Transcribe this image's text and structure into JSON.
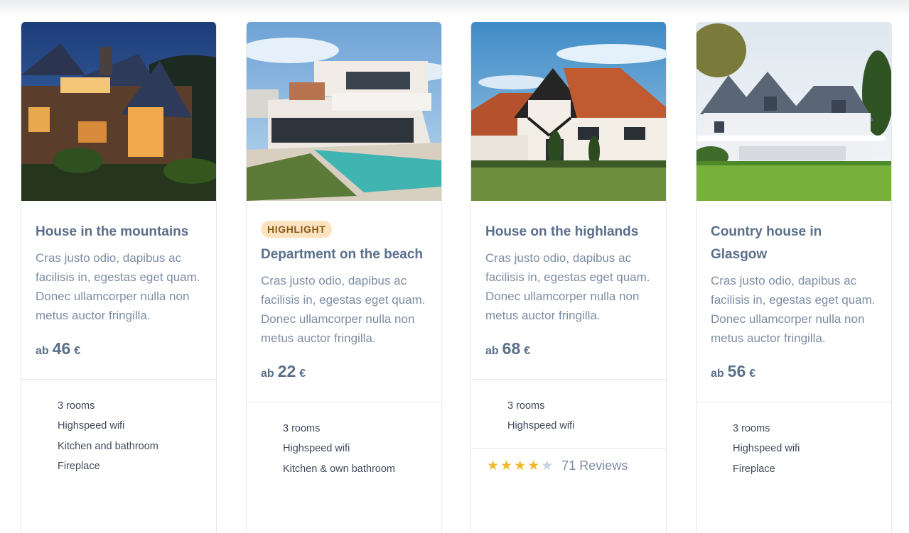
{
  "cards": [
    {
      "title": "House in the mountains",
      "text": "Cras justo odio, dapibus ac facilisis in, egestas eget quam. Donec ullamcorper nulla non metus auctor fringilla.",
      "price_prefix": "ab",
      "price": "46",
      "currency": "€",
      "features": [
        "3 rooms",
        "Highspeed wifi",
        "Kitchen and bathroom",
        "Fireplace"
      ],
      "image": "house-mountains-night-photo"
    },
    {
      "badge": "HIGHLIGHT",
      "title": "Department on the beach",
      "text": "Cras justo odio, dapibus ac facilisis in, egestas eget quam. Donec ullamcorper nulla non metus auctor fringilla.",
      "price_prefix": "ab",
      "price": "22",
      "currency": "€",
      "features": [
        "3 rooms",
        "Highspeed wifi",
        "Kitchen & own bathroom"
      ],
      "image": "modern-beach-villa-pool-photo"
    },
    {
      "title": "House on the highlands",
      "text": "Cras justo odio, dapibus ac facilisis in, egestas eget quam. Donec ullamcorper nulla non metus auctor fringilla.",
      "price_prefix": "ab",
      "price": "68",
      "currency": "€",
      "features": [
        "3 rooms",
        "Highspeed wifi"
      ],
      "rating": 4,
      "rating_max": 5,
      "reviews": "71 Reviews",
      "image": "tudor-house-highlands-photo"
    },
    {
      "title": "Country house in Glasgow",
      "text": "Cras justo odio, dapibus ac facilisis in, egestas eget quam. Donec ullamcorper nulla non metus auctor fringilla.",
      "price_prefix": "ab",
      "price": "56",
      "currency": "€",
      "features": [
        "3 rooms",
        "Highspeed wifi",
        "Fireplace"
      ],
      "image": "country-house-glasgow-photo"
    }
  ],
  "colors": {
    "title": "#5a6f8a",
    "text": "#7d8da3",
    "badge_bg": "#fce3bf",
    "badge_text": "#8a5a1a",
    "star": "#f1b92a",
    "star_empty": "#c9d3e0"
  }
}
